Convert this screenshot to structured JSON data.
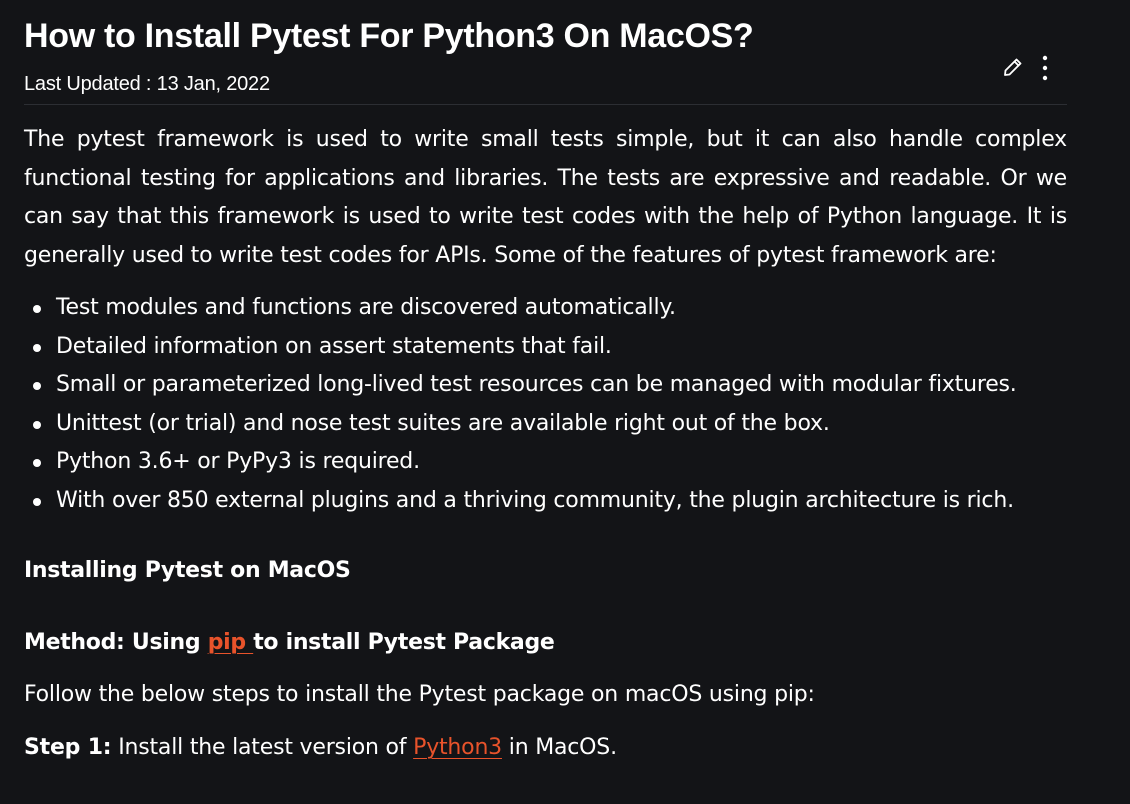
{
  "article": {
    "title": "How to Install Pytest For Python3 On MacOS?",
    "last_updated": "Last Updated : 13 Jan, 2022",
    "intro": "The pytest framework is used to write small tests simple, but it can also handle complex functional testing for applications and libraries. The tests are expressive and readable. Or we can say that this framework is used to write test codes with the help of Python language. It is generally used to write test codes for APIs. Some of the features of pytest framework are:",
    "features": [
      "Test modules and functions are discovered automatically.",
      "Detailed information on assert statements that fail.",
      "Small or parameterized long-lived test resources can be managed with modular fixtures.",
      "Unittest (or trial) and nose test suites are available right out of the box.",
      "Python 3.6+ or PyPy3 is required.",
      "With over 850 external plugins and a thriving community, the plugin architecture is rich."
    ],
    "section_heading": "Installing Pytest on MacOS",
    "method_heading": {
      "prefix": "Method: Using ",
      "link": "pip ",
      "suffix": "to install Pytest Package"
    },
    "follow_text": "Follow the below steps to install the Pytest package on macOS using pip:",
    "step1": {
      "label": "Step 1:",
      "text_before": " Install the latest version of ",
      "link": "Python3",
      "text_after": " in MacOS."
    }
  },
  "toolbar": {
    "edit_icon": "pencil-icon",
    "more_icon": "more-vertical-icon"
  },
  "colors": {
    "background": "#131417",
    "text": "#ffffff",
    "link": "#e8532b"
  }
}
